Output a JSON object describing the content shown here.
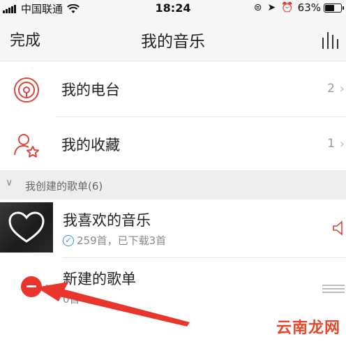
{
  "status_bar": {
    "carrier": "中国联通",
    "time": "18:24",
    "battery_percent": "63%",
    "battery_level": 0.63
  },
  "nav": {
    "done_label": "完成",
    "title": "我的音乐",
    "eq_icon": "equalizer-icon"
  },
  "menu": [
    {
      "label": "我的电台",
      "count": "2",
      "icon": "radio-icon"
    },
    {
      "label": "我的收藏",
      "count": "1",
      "icon": "favorites-icon"
    }
  ],
  "section": {
    "title": "我创建的歌单(6)"
  },
  "playlists": [
    {
      "title": "我喜欢的音乐",
      "subtitle": "259首，已下载3首",
      "icon": "heart-icon"
    },
    {
      "title": "新建的歌单",
      "subtitle": "0首"
    }
  ],
  "watermark": "云南龙网",
  "colors": {
    "accent_red": "#e8362d",
    "check_blue": "#3a8fd6"
  }
}
